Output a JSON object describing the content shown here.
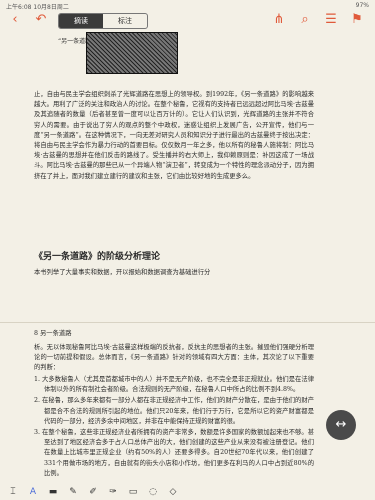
{
  "status": {
    "time": "上午6:08",
    "date": "10月8日周二",
    "battery": "97%"
  },
  "toolbar": {
    "tab_read": "摘读",
    "tab_mark": "标注",
    "icons": [
      "back-icon",
      "undo-icon",
      "share-icon",
      "search-icon",
      "list-icon",
      "bookmark-icon"
    ]
  },
  "page1": {
    "figure_caption": "“另一条道路”。",
    "para1": "止，自由与民主学会组织刺杀了光辉道路在思想上的领导权。到1992年，《另一条道路》的影响越来越大。用利了广泛的关注和政治人的讨论。在整个秘鲁，它视有的支持者已远远超过阿比马埃·古兹曼及其追随者的数量（后者甚至曾一度可以让百万计的）。它让人们认识到，光辉道路的主张并不符合穷人的需要。由于说出了穷人的观点的整个中政权，迷惑让组织上发展广告，公开宣传，他们与一度“另一条道路”。在这种情况下，一向无差对研究人员和知识分子进行最出的古兹曼终于按出决定：将自由与民主学会作为暴力行动的首要目标。仅仅数月一年之多，他以所有的秘鲁人施将制：阿比马埃·古兹曼的思想并在他们反击的路线了。受生播并的右大师上，我仰赖原则是：补因这成了一场战斗。阿比马埃·古兹曼的那些已从一个异端人物“演卫者”，转变成为一个特性的理念派动分子，因为拥挤在了并上，面对我们建立建行的建议和主张，它们由比较好地的生成更多么。",
    "heading": "《另一条道路》的阶级分析理论",
    "para2": "本书列举了大量事实和数据，开以报始和数据调查为基础进行分"
  },
  "page2": {
    "running_head": "8   另一条道路",
    "para1": "析。无以体现秘鲁阿比马埃·古兹曼这样极端的反抗者，反抗主的思想者的主张。摧毁他们强硬分析理论的一切前提和假设。总体而言，《另一条道路》针对的领域有四大方面：主体，其次论了以下重要的判断：",
    "items": [
      "1. 大多数秘鲁人（尤其是首都城市中的人）并不是无产阶级，也不完全是非正规就业。他们是在法律体制以外的所有制社会者阶级。合法规则的无产阶级，在秘鲁人口中所占的比例不到4.8%。",
      "2. 在秘鲁，那么多年来都有一部分人都在非正规经济中工作，他们的财产分散在，是由于他们的财产都是合不合法的规则所引起的地位。他们只20年来，他们行于万行，它是所以它的资产财富都是代码的一部分，经济多余中间地区，并非在中能保持正规的财富的很。",
      "3. 在整个秘鲁，这些非正规经济业者所拥有的资产非常多，数额是许多国家的数额加起来也不够。甚至达到了地区经济会多于占人口总体产出的大，他们创建的这些产业从来没有被注册登记。他们在数量上比城市里正规企业（约有50%的人）还要多得多。自20世纪70年代以来，他们创建了331个用做市场的地方，自由就有的街头小店和小作坊，他们更多在利马的人口中占到近80%的比例。"
    ]
  },
  "bottombar": {
    "icons": [
      "text-cursor-icon",
      "font-icon",
      "highlighter-icon",
      "pen-icon",
      "pencil-icon",
      "brush-icon",
      "eraser-icon",
      "lasso-icon",
      "shapes-icon"
    ]
  }
}
